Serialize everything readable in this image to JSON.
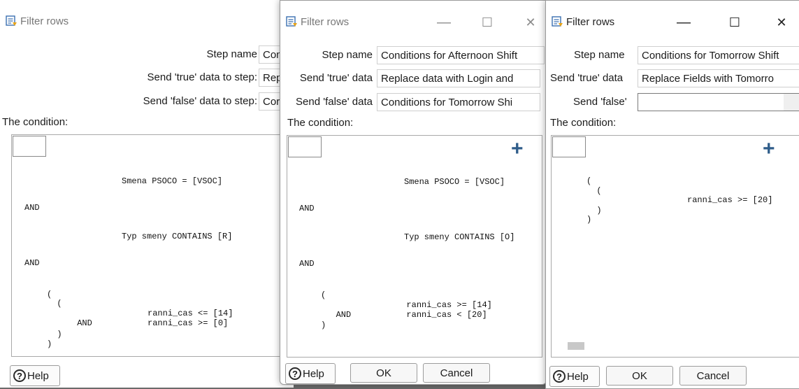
{
  "windows": [
    {
      "title": "Filter rows",
      "step_name_label": "Step name",
      "step_name_value": "Con",
      "true_label": "Send 'true' data to step:",
      "true_value": "Rep",
      "false_label": "Send 'false' data to step:",
      "false_value": "Cor",
      "condition_label": "The condition:",
      "condition_lines": [
        "Smena PSOCO = [VSOC]",
        "AND",
        "Typ smeny CONTAINS [R]",
        "AND",
        "(",
        "  (",
        "                    ranni_cas <= [14]",
        "      AND           ranni_cas >= [0]",
        "  )",
        ")"
      ],
      "help_label": "Help"
    },
    {
      "title": "Filter rows",
      "step_name_label": "Step name",
      "step_name_value": "Conditions for Afternoon Shift",
      "true_label": "Send 'true' data",
      "true_value": "Replace data with Login and",
      "false_label": "Send 'false' data",
      "false_value": "Conditions for Tomorrow Shi",
      "condition_label": "The condition:",
      "condition_lines": [
        "Smena PSOCO = [VSOC]",
        "AND",
        "Typ smeny CONTAINS [O]",
        "AND",
        "(",
        "                 ranni_cas >= [14]",
        "   AND           ranni_cas < [20]",
        ")"
      ],
      "help_label": "Help",
      "ok_label": "OK",
      "cancel_label": "Cancel",
      "minimize_glyph": "—",
      "maximize_glyph": "☐",
      "close_glyph": "✕"
    },
    {
      "title": "Filter rows",
      "step_name_label": "Step name",
      "step_name_value": "Conditions for Tomorrow Shift",
      "true_label": "Send 'true' data",
      "true_value": "Replace Fields with Tomorro",
      "false_label": "Send 'false'",
      "false_value": "",
      "condition_label": "The condition:",
      "condition_lines": [
        "(",
        "  (",
        "                    ranni_cas >= [20]",
        "  )",
        ")"
      ],
      "help_label": "Help",
      "ok_label": "OK",
      "cancel_label": "Cancel",
      "minimize_glyph": "—",
      "maximize_glyph": "☐",
      "close_glyph": "✕"
    }
  ],
  "icons": {
    "title_icon": "filter-rows-step-icon",
    "add_icon": "plus-icon",
    "help_icon": "question-circle-icon"
  },
  "colors": {
    "plus": "#2f5d8a",
    "window_bg": "#ffffff"
  }
}
